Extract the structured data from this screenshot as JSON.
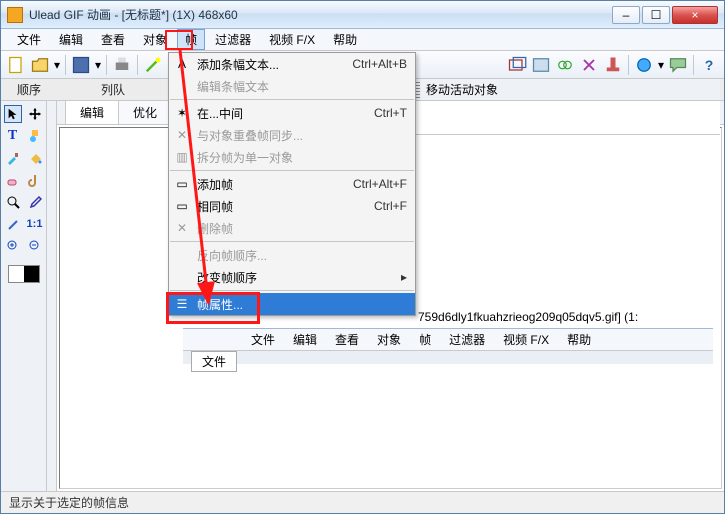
{
  "title": "Ulead GIF 动画 - [无标题*] (1X) 468x60",
  "menus": [
    "文件",
    "编辑",
    "查看",
    "对象",
    "帧",
    "过滤器",
    "视频 F/X",
    "帮助"
  ],
  "secbar": {
    "a": "顺序",
    "b": "列队"
  },
  "tabs": {
    "edit": "编辑",
    "opt": "优化"
  },
  "panel": {
    "title": "移动活动对象"
  },
  "dropdown": {
    "addStripText": "添加条幅文本...",
    "addStripText_sc": "Ctrl+Alt+B",
    "editStripText": "编辑条幅文本",
    "between": "在...中间",
    "between_sc": "Ctrl+T",
    "syncOverlap": "与对象重叠帧同步...",
    "splitSingle": "拆分帧为单一对象",
    "addFrame": "添加帧",
    "addFrame_sc": "Ctrl+Alt+F",
    "sameFrame": "相同帧",
    "sameFrame_sc": "Ctrl+F",
    "delFrame": "删除帧",
    "reverseOrder": "反向帧顺序...",
    "changeOrder": "改变帧顺序",
    "frameProps": "帧属性..."
  },
  "subtitle_fragment": "759d6dly1fkuahzrieog209q05dqv5.gif]  (1:",
  "sub_tabs": "文件",
  "status": "显示关于选定的帧信息",
  "icons": {
    "min": "–",
    "max": "☐",
    "close": "×"
  }
}
